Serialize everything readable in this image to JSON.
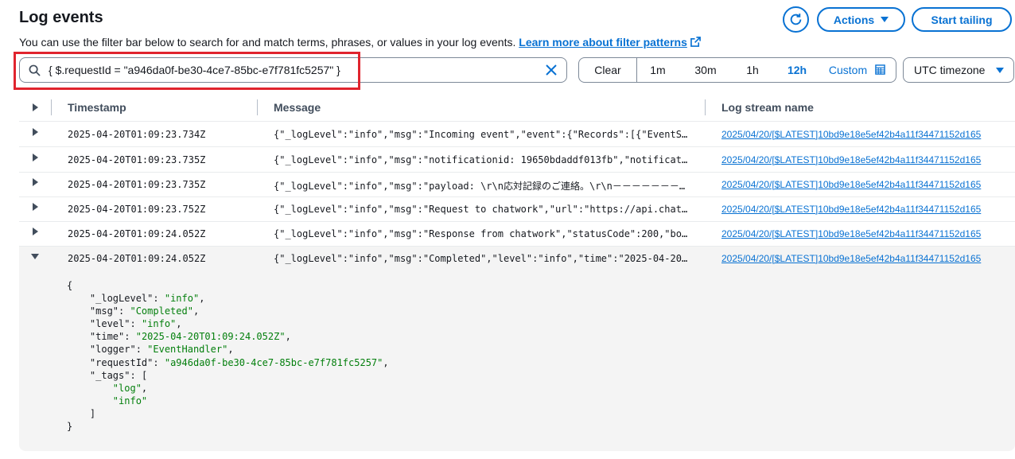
{
  "header": {
    "title": "Log events",
    "description": "You can use the filter bar below to search for and match terms, phrases, or values in your log events.",
    "learn_more_link": "Learn more about filter patterns",
    "actions_label": "Actions",
    "start_tailing_label": "Start tailing"
  },
  "filter": {
    "value": "{ $.requestId = \"a946da0f-be30-4ce7-85bc-e7f781fc5257\" }"
  },
  "time_range": {
    "clear": "Clear",
    "options": [
      "1m",
      "30m",
      "1h",
      "12h"
    ],
    "selected": "12h",
    "custom": "Custom"
  },
  "timezone": {
    "selected": "UTC timezone"
  },
  "table": {
    "columns": [
      "Timestamp",
      "Message",
      "Log stream name"
    ],
    "rows": [
      {
        "timestamp": "2025-04-20T01:09:23.734Z",
        "message": "{\"_logLevel\":\"info\",\"msg\":\"Incoming event\",\"event\":{\"Records\":[{\"EventS…",
        "stream": "2025/04/20/[$LATEST]10bd9e18e5ef42b4a11f34471152d165"
      },
      {
        "timestamp": "2025-04-20T01:09:23.735Z",
        "message": "{\"_logLevel\":\"info\",\"msg\":\"notificationid: 19650bdaddf013fb\",\"notificat…",
        "stream": "2025/04/20/[$LATEST]10bd9e18e5ef42b4a11f34471152d165"
      },
      {
        "timestamp": "2025-04-20T01:09:23.735Z",
        "message": "{\"_logLevel\":\"info\",\"msg\":\"payload: \\r\\n応対記録のご連絡。\\r\\n－－－－－－－…",
        "stream": "2025/04/20/[$LATEST]10bd9e18e5ef42b4a11f34471152d165"
      },
      {
        "timestamp": "2025-04-20T01:09:23.752Z",
        "message": "{\"_logLevel\":\"info\",\"msg\":\"Request to chatwork\",\"url\":\"https://api.chat…",
        "stream": "2025/04/20/[$LATEST]10bd9e18e5ef42b4a11f34471152d165"
      },
      {
        "timestamp": "2025-04-20T01:09:24.052Z",
        "message": "{\"_logLevel\":\"info\",\"msg\":\"Response from chatwork\",\"statusCode\":200,\"bo…",
        "stream": "2025/04/20/[$LATEST]10bd9e18e5ef42b4a11f34471152d165"
      },
      {
        "timestamp": "2025-04-20T01:09:24.052Z",
        "message": "{\"_logLevel\":\"info\",\"msg\":\"Completed\",\"level\":\"info\",\"time\":\"2025-04-20…",
        "stream": "2025/04/20/[$LATEST]10bd9e18e5ef42b4a11f34471152d165"
      }
    ]
  },
  "expanded": {
    "open_brace": "{",
    "fields": [
      {
        "key": "\"_logLevel\"",
        "value": "\"info\""
      },
      {
        "key": "\"msg\"",
        "value": "\"Completed\""
      },
      {
        "key": "\"level\"",
        "value": "\"info\""
      },
      {
        "key": "\"time\"",
        "value": "\"2025-04-20T01:09:24.052Z\""
      },
      {
        "key": "\"logger\"",
        "value": "\"EventHandler\""
      },
      {
        "key": "\"requestId\"",
        "value": "\"a946da0f-be30-4ce7-85bc-e7f781fc5257\""
      }
    ],
    "tags_key": "\"_tags\"",
    "tags_open": "[",
    "tags": [
      "\"log\"",
      "\"info\""
    ],
    "tags_close": "]",
    "close_brace": "}"
  },
  "colors": {
    "accent": "#0972d3",
    "highlight_border": "#e0242e",
    "json_value": "#037f0c"
  }
}
